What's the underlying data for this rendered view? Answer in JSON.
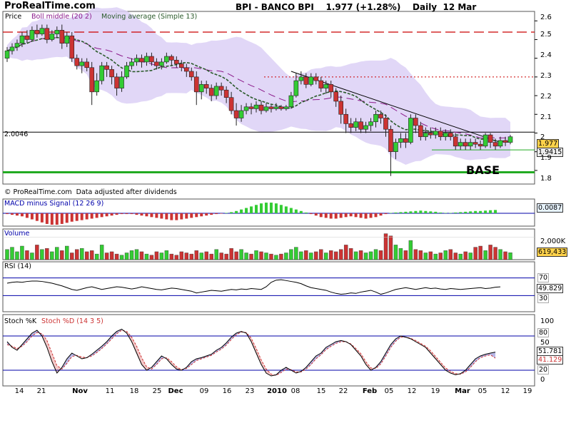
{
  "header": {
    "site": "ProRealTime.com",
    "title": "BPI - BANCO BPI    1.977 (+1.28%)    Daily  12 Mar"
  },
  "colors": {
    "bollinger_band": "#dcd0f6",
    "bollinger_middle": "#8b1a8b",
    "moving_average": "#2a5a2a",
    "candle_up": "#33cc33",
    "candle_down": "#cc3333",
    "resistance": "#cc0000",
    "support": "#22aa22",
    "indicator_line": "#0000aa"
  },
  "price_panel": {
    "legend_price": "Price",
    "legend_boll": "Boll middle (20 2)",
    "legend_ma": "Moving average (Simple 13)",
    "left_value": "2.0046",
    "last_price": "1.977",
    "boll_value": "1.9415",
    "base_label": "BASE",
    "source": "© ProRealTime.com  Data adjusted after dividends",
    "y_ticks": [
      "2.6",
      "2.5",
      "2.4",
      "2.3",
      "2.2",
      "2.1",
      "2",
      "1.9",
      "1.8"
    ]
  },
  "macd_panel": {
    "title": "MACD minus Signal (12 26 9)",
    "value": "0.0087"
  },
  "volume_panel": {
    "title": "Volume",
    "y_tick": "2,000K",
    "value": "619,433"
  },
  "rsi_panel": {
    "title": "RSI (14)",
    "value": "49.829",
    "levels": [
      "70",
      "30"
    ]
  },
  "stoch_panel": {
    "title_k": "Stoch %K",
    "title_d": "Stoch %D (14 3 5)",
    "value_k": "51.781",
    "value_d": "41.129",
    "levels": [
      "80",
      "20"
    ],
    "y_ticks": [
      "100",
      "50",
      "0"
    ]
  },
  "x_axis": {
    "labels": [
      "14",
      "21",
      "Nov",
      "11",
      "18",
      "25",
      "Dec",
      "09",
      "16",
      "23",
      "2010",
      "08",
      "15",
      "22",
      "Feb",
      "05",
      "12",
      "19",
      "Mar",
      "05",
      "12",
      "19"
    ]
  },
  "chart_data": {
    "type": "candlestick",
    "title": "BPI - BANCO BPI",
    "ylim": [
      1.75,
      2.62
    ],
    "resistance_level": 2.54,
    "resistance_level_2": 2.3,
    "support_level": 1.79,
    "base_level": 1.91,
    "current_value": 2.0046,
    "candles": [
      [
        2.4,
        2.44,
        2.46,
        2.38
      ],
      [
        2.44,
        2.46,
        2.48,
        2.42
      ],
      [
        2.46,
        2.48,
        2.5,
        2.44
      ],
      [
        2.48,
        2.52,
        2.54,
        2.46
      ],
      [
        2.52,
        2.5,
        2.55,
        2.48
      ],
      [
        2.5,
        2.55,
        2.57,
        2.49
      ],
      [
        2.55,
        2.53,
        2.58,
        2.51
      ],
      [
        2.53,
        2.56,
        2.58,
        2.52
      ],
      [
        2.56,
        2.5,
        2.58,
        2.48
      ],
      [
        2.5,
        2.53,
        2.55,
        2.49
      ],
      [
        2.53,
        2.55,
        2.57,
        2.51
      ],
      [
        2.55,
        2.48,
        2.58,
        2.45
      ],
      [
        2.48,
        2.52,
        2.54,
        2.46
      ],
      [
        2.52,
        2.4,
        2.54,
        2.38
      ],
      [
        2.4,
        2.36,
        2.42,
        2.34
      ],
      [
        2.36,
        2.38,
        2.4,
        2.32
      ],
      [
        2.38,
        2.35,
        2.4,
        2.33
      ],
      [
        2.35,
        2.22,
        2.38,
        2.15
      ],
      [
        2.22,
        2.28,
        2.32,
        2.2
      ],
      [
        2.28,
        2.36,
        2.38,
        2.26
      ],
      [
        2.36,
        2.34,
        2.38,
        2.3
      ],
      [
        2.34,
        2.3,
        2.36,
        2.26
      ],
      [
        2.3,
        2.24,
        2.32,
        2.2
      ],
      [
        2.24,
        2.3,
        2.33,
        2.22
      ],
      [
        2.3,
        2.36,
        2.38,
        2.29
      ],
      [
        2.36,
        2.38,
        2.4,
        2.34
      ],
      [
        2.38,
        2.4,
        2.42,
        2.36
      ],
      [
        2.4,
        2.38,
        2.42,
        2.35
      ],
      [
        2.38,
        2.41,
        2.43,
        2.36
      ],
      [
        2.41,
        2.38,
        2.43,
        2.36
      ],
      [
        2.38,
        2.36,
        2.4,
        2.34
      ],
      [
        2.36,
        2.38,
        2.4,
        2.34
      ],
      [
        2.38,
        2.41,
        2.43,
        2.37
      ],
      [
        2.41,
        2.39,
        2.42,
        2.36
      ],
      [
        2.39,
        2.37,
        2.41,
        2.35
      ],
      [
        2.37,
        2.35,
        2.39,
        2.33
      ],
      [
        2.35,
        2.33,
        2.37,
        2.3
      ],
      [
        2.33,
        2.3,
        2.35,
        2.28
      ],
      [
        2.3,
        2.22,
        2.33,
        2.15
      ],
      [
        2.22,
        2.26,
        2.28,
        2.18
      ],
      [
        2.26,
        2.24,
        2.28,
        2.21
      ],
      [
        2.24,
        2.2,
        2.26,
        2.17
      ],
      [
        2.2,
        2.25,
        2.27,
        2.18
      ],
      [
        2.25,
        2.23,
        2.27,
        2.2
      ],
      [
        2.23,
        2.19,
        2.25,
        2.16
      ],
      [
        2.19,
        2.12,
        2.22,
        2.1
      ],
      [
        2.12,
        2.08,
        2.16,
        2.04
      ],
      [
        2.08,
        2.12,
        2.15,
        2.06
      ],
      [
        2.12,
        2.14,
        2.16,
        2.1
      ],
      [
        2.14,
        2.13,
        2.16,
        2.1
      ],
      [
        2.13,
        2.15,
        2.17,
        2.11
      ],
      [
        2.15,
        2.12,
        2.17,
        2.1
      ],
      [
        2.12,
        2.14,
        2.16,
        2.11
      ],
      [
        2.14,
        2.13,
        2.15,
        2.11
      ],
      [
        2.13,
        2.14,
        2.16,
        2.12
      ],
      [
        2.14,
        2.13,
        2.15,
        2.12
      ],
      [
        2.13,
        2.14,
        2.15,
        2.12
      ],
      [
        2.14,
        2.2,
        2.22,
        2.13
      ],
      [
        2.2,
        2.28,
        2.32,
        2.19
      ],
      [
        2.28,
        2.3,
        2.33,
        2.26
      ],
      [
        2.3,
        2.26,
        2.32,
        2.24
      ],
      [
        2.26,
        2.3,
        2.32,
        2.25
      ],
      [
        2.3,
        2.28,
        2.32,
        2.26
      ],
      [
        2.28,
        2.24,
        2.3,
        2.22
      ],
      [
        2.24,
        2.26,
        2.28,
        2.21
      ],
      [
        2.26,
        2.22,
        2.28,
        2.19
      ],
      [
        2.22,
        2.17,
        2.24,
        2.14
      ],
      [
        2.17,
        2.1,
        2.2,
        2.05
      ],
      [
        2.1,
        2.05,
        2.13,
        2.0
      ],
      [
        2.05,
        2.03,
        2.08,
        2.0
      ],
      [
        2.03,
        2.06,
        2.08,
        2.01
      ],
      [
        2.06,
        2.02,
        2.08,
        2.0
      ],
      [
        2.02,
        2.04,
        2.06,
        2.0
      ],
      [
        2.04,
        2.06,
        2.08,
        2.01
      ],
      [
        2.06,
        2.1,
        2.12,
        2.03
      ],
      [
        2.1,
        2.08,
        2.12,
        2.05
      ],
      [
        2.08,
        2.02,
        2.1,
        1.98
      ],
      [
        2.02,
        1.9,
        2.04,
        1.77
      ],
      [
        1.9,
        1.95,
        1.97,
        1.86
      ],
      [
        1.95,
        1.97,
        2.0,
        1.92
      ],
      [
        1.97,
        1.95,
        2.0,
        1.92
      ],
      [
        1.95,
        2.08,
        2.1,
        1.94
      ],
      [
        2.08,
        2.04,
        2.1,
        2.0
      ],
      [
        2.04,
        1.98,
        2.06,
        1.96
      ],
      [
        1.98,
        2.0,
        2.03,
        1.96
      ],
      [
        2.0,
        1.99,
        2.03,
        1.97
      ],
      [
        1.99,
        2.01,
        2.03,
        1.97
      ],
      [
        2.01,
        1.98,
        2.03,
        1.96
      ],
      [
        1.98,
        2.0,
        2.02,
        1.96
      ],
      [
        2.0,
        1.98,
        2.02,
        1.96
      ],
      [
        1.98,
        1.93,
        2.0,
        1.91
      ],
      [
        1.93,
        1.95,
        1.97,
        1.91
      ],
      [
        1.95,
        1.93,
        1.97,
        1.91
      ],
      [
        1.93,
        1.95,
        1.97,
        1.91
      ],
      [
        1.95,
        1.94,
        1.97,
        1.92
      ],
      [
        1.94,
        1.93,
        1.96,
        1.91
      ],
      [
        1.93,
        1.99,
        2.0,
        1.92
      ],
      [
        1.99,
        1.95,
        2.0,
        1.92
      ],
      [
        1.95,
        1.93,
        1.97,
        1.91
      ],
      [
        1.93,
        1.96,
        1.98,
        1.92
      ],
      [
        1.96,
        1.95,
        1.98,
        1.93
      ],
      [
        1.95,
        1.98,
        1.99,
        1.94
      ]
    ],
    "macd": [
      -0.002,
      -0.004,
      -0.006,
      -0.008,
      -0.012,
      -0.016,
      -0.02,
      -0.024,
      -0.028,
      -0.03,
      -0.03,
      -0.028,
      -0.025,
      -0.022,
      -0.02,
      -0.018,
      -0.016,
      -0.014,
      -0.012,
      -0.01,
      -0.008,
      -0.006,
      -0.004,
      -0.002,
      -0.002,
      -0.002,
      -0.004,
      -0.006,
      -0.008,
      -0.01,
      -0.012,
      -0.014,
      -0.016,
      -0.018,
      -0.018,
      -0.016,
      -0.014,
      -0.012,
      -0.01,
      -0.008,
      -0.006,
      -0.004,
      -0.002,
      -0.001,
      0.001,
      0.003,
      0.006,
      0.01,
      0.014,
      0.018,
      0.022,
      0.026,
      0.028,
      0.028,
      0.026,
      0.022,
      0.018,
      0.014,
      0.01,
      0.006,
      0.002,
      -0.002,
      -0.006,
      -0.01,
      -0.012,
      -0.014,
      -0.014,
      -0.012,
      -0.01,
      -0.008,
      -0.01,
      -0.012,
      -0.014,
      -0.012,
      -0.01,
      -0.006,
      -0.002,
      0.001,
      0.002,
      0.003,
      0.004,
      0.005,
      0.006,
      0.007,
      0.006,
      0.005,
      0.004,
      0.002,
      0.001,
      0.001,
      0.002,
      0.003,
      0.004,
      0.005,
      0.006,
      0.006,
      0.007,
      0.008,
      0.0087
    ],
    "volume": [
      900,
      1100,
      700,
      1200,
      800,
      600,
      1300,
      900,
      1000,
      700,
      1100,
      800,
      1200,
      600,
      900,
      1000,
      700,
      800,
      500,
      1300,
      600,
      700,
      500,
      400,
      600,
      800,
      900,
      700,
      500,
      400,
      700,
      600,
      800,
      500,
      400,
      700,
      600,
      500,
      800,
      600,
      700,
      500,
      900,
      600,
      500,
      1000,
      700,
      900,
      600,
      500,
      800,
      700,
      600,
      500,
      400,
      500,
      600,
      900,
      1100,
      700,
      800,
      600,
      700,
      900,
      600,
      800,
      700,
      900,
      1300,
      1000,
      700,
      800,
      600,
      700,
      900,
      800,
      2300,
      2100,
      1300,
      1000,
      800,
      1700,
      900,
      800,
      600,
      700,
      500,
      600,
      800,
      900,
      600,
      500,
      700,
      600,
      1100,
      1200,
      800,
      1300,
      1100,
      900,
      700,
      619
    ],
    "rsi": [
      58,
      60,
      61,
      60,
      62,
      63,
      63,
      62,
      60,
      58,
      55,
      52,
      48,
      44,
      42,
      45,
      48,
      50,
      47,
      44,
      46,
      48,
      50,
      49,
      47,
      45,
      47,
      50,
      48,
      46,
      44,
      43,
      45,
      47,
      46,
      44,
      42,
      40,
      36,
      38,
      40,
      42,
      41,
      40,
      42,
      44,
      43,
      45,
      44,
      46,
      45,
      44,
      50,
      60,
      65,
      66,
      64,
      62,
      60,
      57,
      52,
      48,
      46,
      44,
      42,
      38,
      35,
      33,
      34,
      36,
      35,
      38,
      40,
      42,
      38,
      33,
      36,
      40,
      44,
      46,
      48,
      46,
      44,
      46,
      48,
      46,
      47,
      45,
      44,
      46,
      45,
      44,
      45,
      46,
      47,
      48,
      46,
      47,
      49,
      49.829
    ],
    "stoch_k": [
      70,
      60,
      55,
      65,
      75,
      85,
      90,
      80,
      60,
      35,
      15,
      25,
      40,
      50,
      45,
      40,
      42,
      48,
      55,
      62,
      70,
      80,
      88,
      92,
      85,
      70,
      50,
      30,
      20,
      25,
      35,
      45,
      40,
      30,
      22,
      20,
      25,
      35,
      40,
      42,
      45,
      48,
      55,
      60,
      68,
      78,
      85,
      88,
      85,
      70,
      50,
      30,
      15,
      10,
      12,
      20,
      25,
      20,
      15,
      18,
      25,
      35,
      45,
      50,
      60,
      65,
      70,
      72,
      70,
      65,
      55,
      45,
      30,
      20,
      25,
      35,
      50,
      65,
      75,
      80,
      78,
      75,
      70,
      65,
      60,
      50,
      40,
      30,
      20,
      15,
      12,
      14,
      20,
      30,
      40,
      45,
      48,
      50,
      51.781
    ],
    "stoch_d": [
      65,
      62,
      58,
      62,
      70,
      80,
      86,
      84,
      72,
      50,
      28,
      22,
      32,
      44,
      46,
      43,
      42,
      45,
      51,
      58,
      66,
      75,
      84,
      90,
      88,
      78,
      62,
      42,
      26,
      22,
      30,
      40,
      42,
      35,
      26,
      21,
      23,
      30,
      37,
      40,
      43,
      46,
      52,
      57,
      64,
      74,
      82,
      87,
      86,
      76,
      58,
      38,
      22,
      13,
      11,
      16,
      22,
      21,
      17,
      17,
      22,
      30,
      40,
      47,
      56,
      62,
      67,
      70,
      70,
      66,
      58,
      49,
      35,
      24,
      23,
      31,
      45,
      60,
      71,
      78,
      78,
      76,
      72,
      67,
      62,
      54,
      44,
      34,
      24,
      18,
      14,
      13,
      17,
      25,
      35,
      42,
      45,
      47,
      41.129
    ]
  }
}
